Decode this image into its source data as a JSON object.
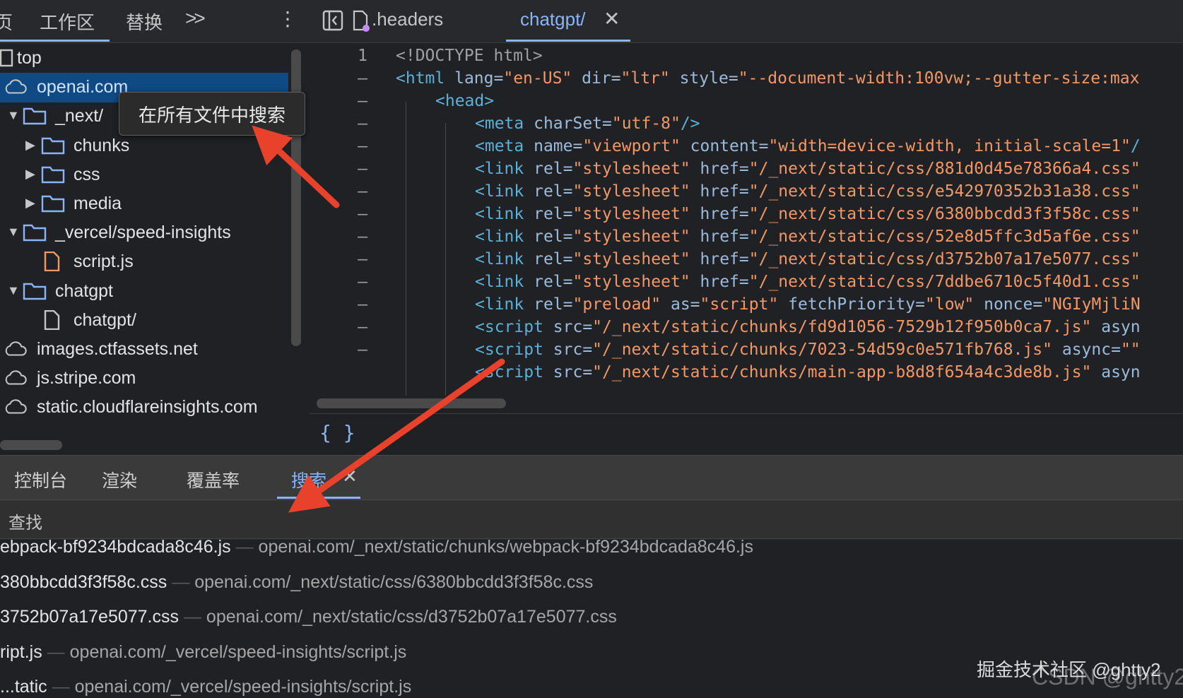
{
  "left_tabs": {
    "partial": "页",
    "workspace": "工作区",
    "overrides": "替换",
    "more": ">>",
    "menu": "⋮"
  },
  "tree": {
    "items": [
      {
        "label": "top",
        "icon": "frame-icon"
      },
      {
        "label": "openai.com",
        "icon": "cloud-icon",
        "selected": true
      },
      {
        "label": "_next/",
        "icon": "folder-icon",
        "expanded": true
      },
      {
        "label": "chunks",
        "icon": "folder-icon",
        "expanded": false
      },
      {
        "label": "css",
        "icon": "folder-icon",
        "expanded": false
      },
      {
        "label": "media",
        "icon": "folder-icon",
        "expanded": false
      },
      {
        "label": "_vercel/speed-insights",
        "icon": "folder-icon",
        "expanded": true
      },
      {
        "label": "script.js",
        "icon": "js-file-icon"
      },
      {
        "label": "chatgpt",
        "icon": "folder-icon",
        "expanded": true
      },
      {
        "label": "chatgpt/",
        "icon": "file-icon"
      },
      {
        "label": "images.ctfassets.net",
        "icon": "cloud-icon"
      },
      {
        "label": "js.stripe.com",
        "icon": "cloud-icon"
      },
      {
        "label": "static.cloudflareinsights.com",
        "icon": "cloud-icon"
      }
    ]
  },
  "tooltip": "在所有文件中搜索",
  "editor_tabs": {
    "headers": ".headers",
    "chatgpt": "chatgpt/",
    "close": "✕"
  },
  "code": {
    "lines": [
      {
        "num": "1",
        "parts": [
          [
            "doc",
            "<!DOCTYPE html>"
          ]
        ]
      },
      {
        "num": "–",
        "parts": [
          [
            "tag",
            "<html "
          ],
          [
            "attr",
            "lang="
          ],
          [
            "val",
            "\"en-US\" "
          ],
          [
            "attr",
            "dir="
          ],
          [
            "val",
            "\"ltr\" "
          ],
          [
            "attr",
            "style="
          ],
          [
            "val",
            "\"--document-width:100vw;--gutter-size:max"
          ]
        ]
      },
      {
        "num": "–",
        "parts": [
          [
            "tag",
            "<head>"
          ]
        ]
      },
      {
        "num": "–",
        "parts": [
          [
            "tag",
            "<meta "
          ],
          [
            "attr",
            "charSet="
          ],
          [
            "val",
            "\"utf-8\""
          ],
          [
            "tag",
            "/>"
          ]
        ]
      },
      {
        "num": "–",
        "parts": [
          [
            "tag",
            "<meta "
          ],
          [
            "attr",
            "name="
          ],
          [
            "val",
            "\"viewport\" "
          ],
          [
            "attr",
            "content="
          ],
          [
            "val",
            "\"width=device-width, initial-scale=1\""
          ],
          [
            "tag",
            "/"
          ]
        ]
      },
      {
        "num": "–",
        "parts": [
          [
            "tag",
            "<link "
          ],
          [
            "attr",
            "rel="
          ],
          [
            "val",
            "\"stylesheet\" "
          ],
          [
            "attr",
            "href="
          ],
          [
            "val",
            "\"/_next/static/css/881d0d45e78366a4.css\""
          ]
        ]
      },
      {
        "num": "–",
        "parts": [
          [
            "tag",
            "<link "
          ],
          [
            "attr",
            "rel="
          ],
          [
            "val",
            "\"stylesheet\" "
          ],
          [
            "attr",
            "href="
          ],
          [
            "val",
            "\"/_next/static/css/e542970352b31a38.css\""
          ]
        ]
      },
      {
        "num": "–",
        "parts": [
          [
            "tag",
            "<link "
          ],
          [
            "attr",
            "rel="
          ],
          [
            "val",
            "\"stylesheet\" "
          ],
          [
            "attr",
            "href="
          ],
          [
            "val",
            "\"/_next/static/css/6380bbcdd3f3f58c.css\""
          ]
        ]
      },
      {
        "num": "–",
        "parts": [
          [
            "tag",
            "<link "
          ],
          [
            "attr",
            "rel="
          ],
          [
            "val",
            "\"stylesheet\" "
          ],
          [
            "attr",
            "href="
          ],
          [
            "val",
            "\"/_next/static/css/52e8d5ffc3d5af6e.css\""
          ]
        ]
      },
      {
        "num": "–",
        "parts": [
          [
            "tag",
            "<link "
          ],
          [
            "attr",
            "rel="
          ],
          [
            "val",
            "\"stylesheet\" "
          ],
          [
            "attr",
            "href="
          ],
          [
            "val",
            "\"/_next/static/css/d3752b07a17e5077.css\""
          ]
        ]
      },
      {
        "num": "–",
        "parts": [
          [
            "tag",
            "<link "
          ],
          [
            "attr",
            "rel="
          ],
          [
            "val",
            "\"stylesheet\" "
          ],
          [
            "attr",
            "href="
          ],
          [
            "val",
            "\"/_next/static/css/7ddbe6710c5f40d1.css\""
          ]
        ]
      },
      {
        "num": "–",
        "parts": [
          [
            "tag",
            "<link "
          ],
          [
            "attr",
            "rel="
          ],
          [
            "val",
            "\"preload\" "
          ],
          [
            "attr",
            "as="
          ],
          [
            "val",
            "\"script\" "
          ],
          [
            "attr",
            "fetchPriority="
          ],
          [
            "val",
            "\"low\" "
          ],
          [
            "attr",
            "nonce="
          ],
          [
            "val",
            "\"NGIyMjliN"
          ]
        ]
      },
      {
        "num": "–",
        "parts": [
          [
            "tag",
            "<script "
          ],
          [
            "attr",
            "src="
          ],
          [
            "val",
            "\"/_next/static/chunks/fd9d1056-7529b12f950b0ca7.js\" "
          ],
          [
            "attr",
            "asyn"
          ]
        ]
      },
      {
        "num": "–",
        "parts": [
          [
            "tag",
            "<script "
          ],
          [
            "attr",
            "src="
          ],
          [
            "val",
            "\"/_next/static/chunks/7023-54d59c0e571fb768.js\" "
          ],
          [
            "attr",
            "async="
          ],
          [
            "val",
            "\"\""
          ]
        ]
      },
      {
        "num": "",
        "parts": [
          [
            "tag",
            "<script "
          ],
          [
            "attr",
            "src="
          ],
          [
            "val",
            "\"/_next/static/chunks/main-app-b8d8f654a4c3de8b.js\" "
          ],
          [
            "attr",
            "asyn"
          ]
        ]
      }
    ]
  },
  "format_button": "{ }",
  "drawer_tabs": {
    "console": "控制台",
    "rendering": "渲染",
    "coverage": "覆盖率",
    "search": "搜索",
    "close": "✕"
  },
  "find_label": "查找",
  "results": [
    {
      "file": "ebpack-bf9234bdcada8c46.js",
      "path": "openai.com/_next/static/chunks/webpack-bf9234bdcada8c46.js"
    },
    {
      "file": "380bbcdd3f3f58c.css",
      "path": "openai.com/_next/static/css/6380bbcdd3f3f58c.css"
    },
    {
      "file": "3752b07a17e5077.css",
      "path": "openai.com/_next/static/css/d3752b07a17e5077.css"
    },
    {
      "file": "ript.js",
      "path": "openai.com/_vercel/speed-insights/script.js"
    },
    {
      "file": "...tatic",
      "path": "openai.com/_vercel/speed-insights/script.js"
    }
  ],
  "watermark": "掘金技术社区 @ghtty2",
  "watermark2": "CSDN @ghtty2",
  "colors": {
    "accent": "#8ab4f8",
    "arrow": "#e8412c",
    "selection": "#0f4a85"
  }
}
